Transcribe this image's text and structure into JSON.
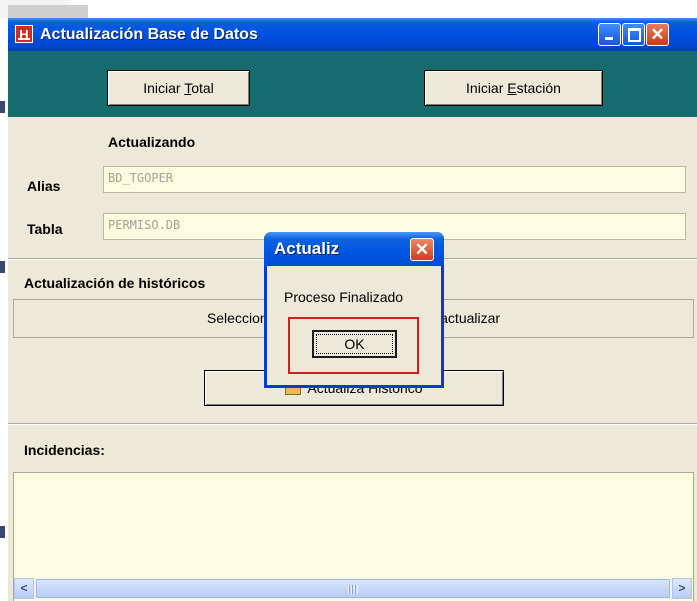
{
  "window": {
    "title": "Actualización Base de Datos",
    "app_icon_letter": "H"
  },
  "top_buttons": {
    "iniciar_total": {
      "before": "Iniciar ",
      "mnemonic": "T",
      "after": "otal"
    },
    "iniciar_estacion": {
      "before": "Iniciar ",
      "mnemonic": "E",
      "after": "stación"
    }
  },
  "updating": {
    "heading": "Actualizando",
    "alias_label": "Alias",
    "alias_value": "BD_TGOPER",
    "tabla_label": "Tabla",
    "tabla_value": "PERMISO.DB"
  },
  "historicos": {
    "heading": "Actualización de históricos",
    "hint_left": "Seleccione el d",
    "hint_right": "esea actualizar",
    "button_label": "Actualiza Histórico"
  },
  "incidencias": {
    "heading": "Incidencias:"
  },
  "dialog": {
    "title": "Actualiz",
    "message": "Proceso Finalizado",
    "ok_label": "OK"
  },
  "icons": {
    "close": "close-icon",
    "minimize": "minimize-icon",
    "maximize": "maximize-icon",
    "folder": "folder-icon",
    "scroll_left": "chevron-left-icon",
    "scroll_right": "chevron-right-icon"
  },
  "colors": {
    "titlebar": "#0054e3",
    "teal_band": "#166b6e",
    "panel": "#ece9d8",
    "field_bg": "#fbfbe0",
    "highlight_frame": "#d21f1f"
  }
}
